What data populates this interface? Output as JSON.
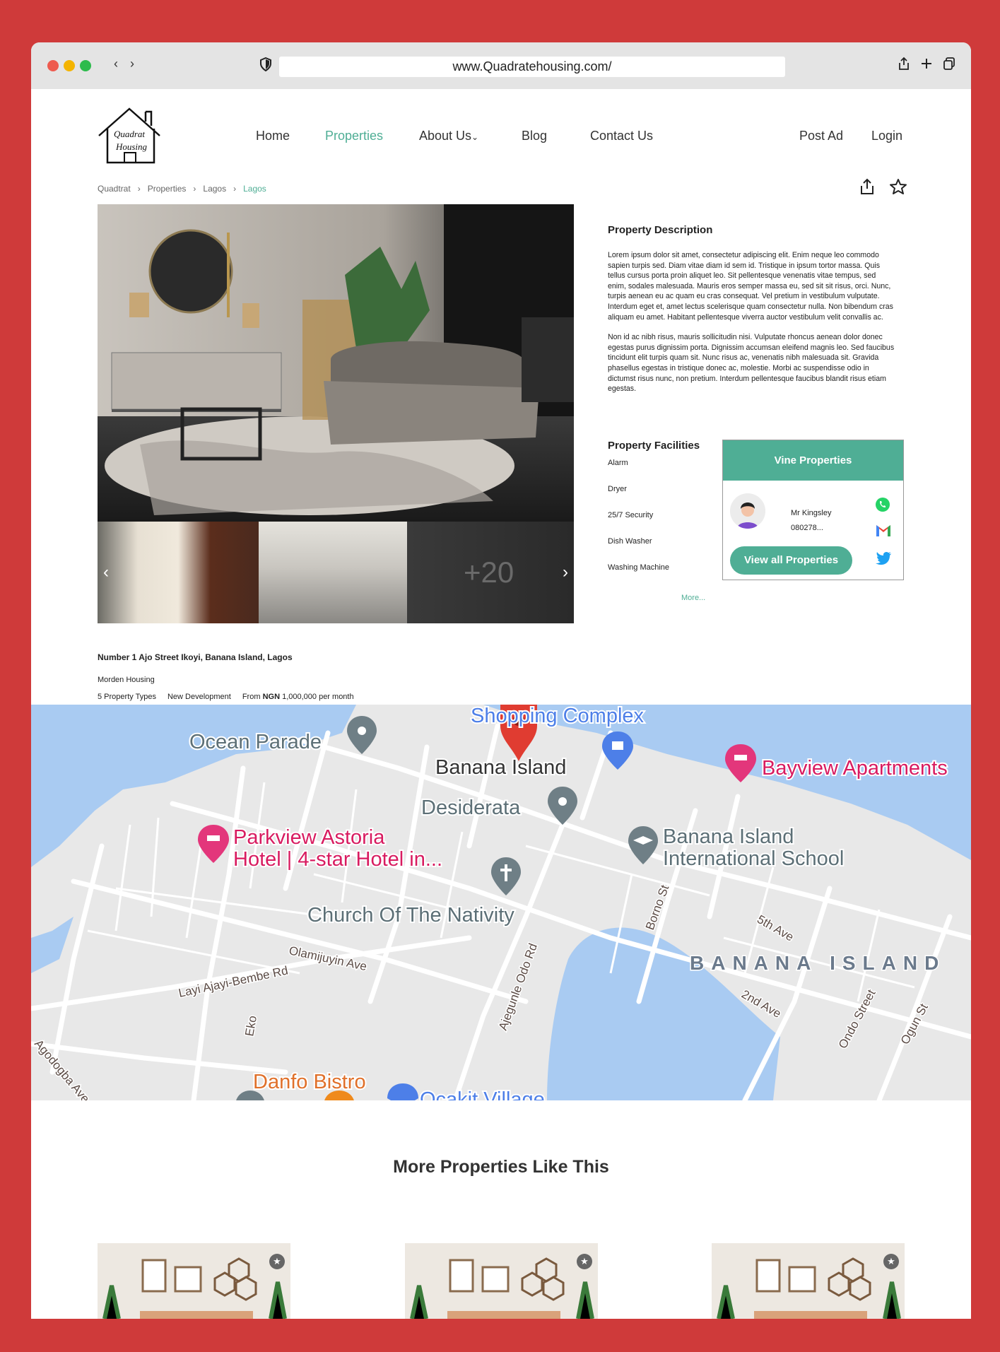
{
  "browser": {
    "url": "www.Quadratehousing.com/"
  },
  "logo": {
    "line1": "Quadrat",
    "line2": "Housing"
  },
  "nav": {
    "home": "Home",
    "properties": "Properties",
    "about": "About Us",
    "blog": "Blog",
    "contact": "Contact Us"
  },
  "auth": {
    "post_ad": "Post Ad",
    "login": "Login"
  },
  "breadcrumb": [
    "Quadtrat",
    "Properties",
    "Lagos",
    "Lagos"
  ],
  "gallery": {
    "more_count": "+20"
  },
  "description": {
    "title": "Property Description",
    "para1": "Lorem ipsum dolor sit amet, consectetur adipiscing elit. Enim neque leo commodo sapien turpis sed. Diam vitae diam id sem id. Tristique in ipsum tortor massa. Quis tellus cursus porta proin aliquet leo. Sit pellentesque venenatis vitae tempus, sed enim, sodales malesuada. Mauris eros semper massa eu, sed sit sit risus, orci. Nunc, turpis aenean eu ac quam eu cras consequat. Vel pretium in vestibulum vulputate. Interdum eget et, amet lectus scelerisque quam consectetur nulla. Non bibendum cras aliquam eu amet. Habitant pellentesque viverra auctor vestibulum velit convallis ac.",
    "para2": "Non id ac nibh risus, mauris sollicitudin nisi. Vulputate rhoncus aenean dolor donec egestas purus dignissim porta. Dignissim accumsan eleifend magnis leo. Sed faucibus tincidunt elit turpis quam sit. Nunc risus ac, venenatis nibh malesuada sit. Gravida phasellus egestas in tristique donec ac, molestie. Morbi ac suspendisse odio in dictumst risus nunc, non pretium. Interdum pellentesque faucibus blandit risus etiam egestas."
  },
  "facilities": {
    "title": "Property Facilities",
    "items": [
      "Alarm",
      "Dryer",
      "25/7 Security",
      "Dish Washer",
      "Washing Machine"
    ],
    "more": "More..."
  },
  "agent": {
    "company": "Vine Properties",
    "name": "Mr Kingsley",
    "phone": "080278...",
    "view_all": "View all Properties"
  },
  "property": {
    "address": "Number 1 Ajo Street Ikoyi, Banana Island, Lagos",
    "category": "Morden Housing",
    "types": "5 Property Types",
    "status": "New Development",
    "price_prefix": "From",
    "currency": "NGN",
    "price": "1,000,000 per month"
  },
  "map": {
    "labels": {
      "ocean_parade": "Ocean Parade",
      "shopping": "Shopping Complex",
      "banana_island": "Banana Island",
      "bayview": "Bayview Apartments",
      "desiderata": "Desiderata",
      "parkview1": "Parkview Astoria",
      "parkview2": "Hotel | 4-star Hotel in...",
      "school1": "Banana Island",
      "school2": "International School",
      "church": "Church Of The Nativity",
      "olamijuyin": "Olamijuyin Ave",
      "layi": "Layi Ajayi-Bembe Rd",
      "borno": "Borno St",
      "fifth": "5th Ave",
      "area": "BANANA ISLAND",
      "second": "2nd Ave",
      "ajegunle": "Ajegunle Odo Rd",
      "ondo": "Ondo Street",
      "ogun": "Ogun St",
      "eko": "Eko",
      "agodogba": "Agodogba Ave",
      "danfo": "Danfo Bistro",
      "ocakit": "Ocakit Village"
    }
  },
  "more_section": {
    "title": "More Properties Like This"
  },
  "colors": {
    "accent": "#4fae95",
    "frame": "#cf3a3a"
  }
}
